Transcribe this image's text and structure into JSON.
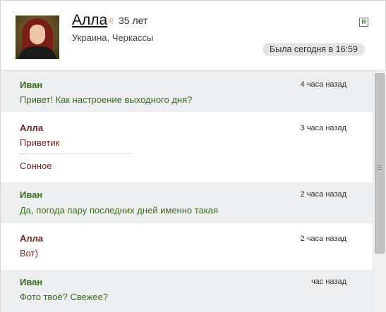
{
  "profile": {
    "name": "Алла",
    "age": "35 лет",
    "location": "Украина, Черкассы",
    "last_seen": "Была сегодня в 16:59",
    "badge": "R",
    "zodiac_icon": "zodiac-icon"
  },
  "colors": {
    "male_author": "#3a6f1d",
    "female_author": "#7d2020",
    "row_gray": "#eceeef"
  },
  "messages": [
    {
      "author": "Иван",
      "time": "4 часа назад",
      "lines": [
        "Привет! Как настроение выходного дня?"
      ]
    },
    {
      "author": "Алла",
      "time": "3 часа назад",
      "lines": [
        "Приветик",
        "Сонное"
      ]
    },
    {
      "author": "Иван",
      "time": "2 часа назад",
      "lines": [
        "Да, погода пару последних дней именно такая"
      ]
    },
    {
      "author": "Алла",
      "time": "2 часа назад",
      "lines": [
        "Вот)"
      ]
    },
    {
      "author": "Иван",
      "time": "час назад",
      "lines": [
        "Фото твоё? Свежее?"
      ]
    }
  ]
}
